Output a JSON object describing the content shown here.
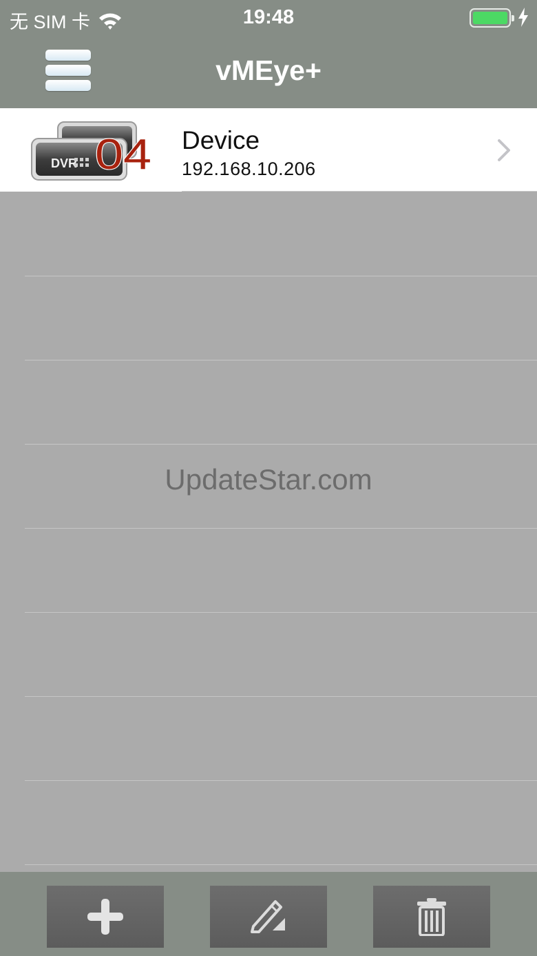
{
  "status_bar": {
    "carrier": "无 SIM 卡",
    "time": "19:48",
    "battery_color": "#4cd964"
  },
  "nav": {
    "title": "vMEye+",
    "menu_icon": "hamburger-menu-icon"
  },
  "devices": [
    {
      "name": "Device",
      "ip": "192.168.10.206",
      "icon_badge_label": "DVR",
      "icon_badge_number": "04"
    }
  ],
  "watermark": "UpdateStar.com",
  "toolbar": {
    "buttons": [
      {
        "name": "add",
        "icon": "plus-icon"
      },
      {
        "name": "edit",
        "icon": "pencil-icon"
      },
      {
        "name": "delete",
        "icon": "trash-icon"
      }
    ]
  },
  "colors": {
    "bar_background": "#868d86",
    "list_background": "#ababab",
    "badge_number": "#a8220e"
  }
}
